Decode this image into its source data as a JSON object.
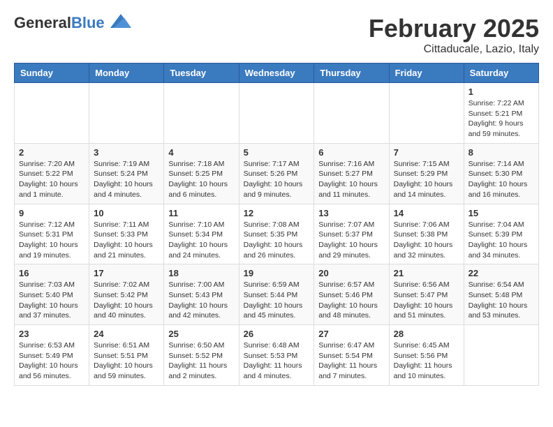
{
  "header": {
    "logo_general": "General",
    "logo_blue": "Blue",
    "month_title": "February 2025",
    "location": "Cittaducale, Lazio, Italy"
  },
  "days_of_week": [
    "Sunday",
    "Monday",
    "Tuesday",
    "Wednesday",
    "Thursday",
    "Friday",
    "Saturday"
  ],
  "weeks": [
    [
      {
        "day": "",
        "info": ""
      },
      {
        "day": "",
        "info": ""
      },
      {
        "day": "",
        "info": ""
      },
      {
        "day": "",
        "info": ""
      },
      {
        "day": "",
        "info": ""
      },
      {
        "day": "",
        "info": ""
      },
      {
        "day": "1",
        "info": "Sunrise: 7:22 AM\nSunset: 5:21 PM\nDaylight: 9 hours\nand 59 minutes."
      }
    ],
    [
      {
        "day": "2",
        "info": "Sunrise: 7:20 AM\nSunset: 5:22 PM\nDaylight: 10 hours\nand 1 minute."
      },
      {
        "day": "3",
        "info": "Sunrise: 7:19 AM\nSunset: 5:24 PM\nDaylight: 10 hours\nand 4 minutes."
      },
      {
        "day": "4",
        "info": "Sunrise: 7:18 AM\nSunset: 5:25 PM\nDaylight: 10 hours\nand 6 minutes."
      },
      {
        "day": "5",
        "info": "Sunrise: 7:17 AM\nSunset: 5:26 PM\nDaylight: 10 hours\nand 9 minutes."
      },
      {
        "day": "6",
        "info": "Sunrise: 7:16 AM\nSunset: 5:27 PM\nDaylight: 10 hours\nand 11 minutes."
      },
      {
        "day": "7",
        "info": "Sunrise: 7:15 AM\nSunset: 5:29 PM\nDaylight: 10 hours\nand 14 minutes."
      },
      {
        "day": "8",
        "info": "Sunrise: 7:14 AM\nSunset: 5:30 PM\nDaylight: 10 hours\nand 16 minutes."
      }
    ],
    [
      {
        "day": "9",
        "info": "Sunrise: 7:12 AM\nSunset: 5:31 PM\nDaylight: 10 hours\nand 19 minutes."
      },
      {
        "day": "10",
        "info": "Sunrise: 7:11 AM\nSunset: 5:33 PM\nDaylight: 10 hours\nand 21 minutes."
      },
      {
        "day": "11",
        "info": "Sunrise: 7:10 AM\nSunset: 5:34 PM\nDaylight: 10 hours\nand 24 minutes."
      },
      {
        "day": "12",
        "info": "Sunrise: 7:08 AM\nSunset: 5:35 PM\nDaylight: 10 hours\nand 26 minutes."
      },
      {
        "day": "13",
        "info": "Sunrise: 7:07 AM\nSunset: 5:37 PM\nDaylight: 10 hours\nand 29 minutes."
      },
      {
        "day": "14",
        "info": "Sunrise: 7:06 AM\nSunset: 5:38 PM\nDaylight: 10 hours\nand 32 minutes."
      },
      {
        "day": "15",
        "info": "Sunrise: 7:04 AM\nSunset: 5:39 PM\nDaylight: 10 hours\nand 34 minutes."
      }
    ],
    [
      {
        "day": "16",
        "info": "Sunrise: 7:03 AM\nSunset: 5:40 PM\nDaylight: 10 hours\nand 37 minutes."
      },
      {
        "day": "17",
        "info": "Sunrise: 7:02 AM\nSunset: 5:42 PM\nDaylight: 10 hours\nand 40 minutes."
      },
      {
        "day": "18",
        "info": "Sunrise: 7:00 AM\nSunset: 5:43 PM\nDaylight: 10 hours\nand 42 minutes."
      },
      {
        "day": "19",
        "info": "Sunrise: 6:59 AM\nSunset: 5:44 PM\nDaylight: 10 hours\nand 45 minutes."
      },
      {
        "day": "20",
        "info": "Sunrise: 6:57 AM\nSunset: 5:46 PM\nDaylight: 10 hours\nand 48 minutes."
      },
      {
        "day": "21",
        "info": "Sunrise: 6:56 AM\nSunset: 5:47 PM\nDaylight: 10 hours\nand 51 minutes."
      },
      {
        "day": "22",
        "info": "Sunrise: 6:54 AM\nSunset: 5:48 PM\nDaylight: 10 hours\nand 53 minutes."
      }
    ],
    [
      {
        "day": "23",
        "info": "Sunrise: 6:53 AM\nSunset: 5:49 PM\nDaylight: 10 hours\nand 56 minutes."
      },
      {
        "day": "24",
        "info": "Sunrise: 6:51 AM\nSunset: 5:51 PM\nDaylight: 10 hours\nand 59 minutes."
      },
      {
        "day": "25",
        "info": "Sunrise: 6:50 AM\nSunset: 5:52 PM\nDaylight: 11 hours\nand 2 minutes."
      },
      {
        "day": "26",
        "info": "Sunrise: 6:48 AM\nSunset: 5:53 PM\nDaylight: 11 hours\nand 4 minutes."
      },
      {
        "day": "27",
        "info": "Sunrise: 6:47 AM\nSunset: 5:54 PM\nDaylight: 11 hours\nand 7 minutes."
      },
      {
        "day": "28",
        "info": "Sunrise: 6:45 AM\nSunset: 5:56 PM\nDaylight: 11 hours\nand 10 minutes."
      },
      {
        "day": "",
        "info": ""
      }
    ]
  ]
}
